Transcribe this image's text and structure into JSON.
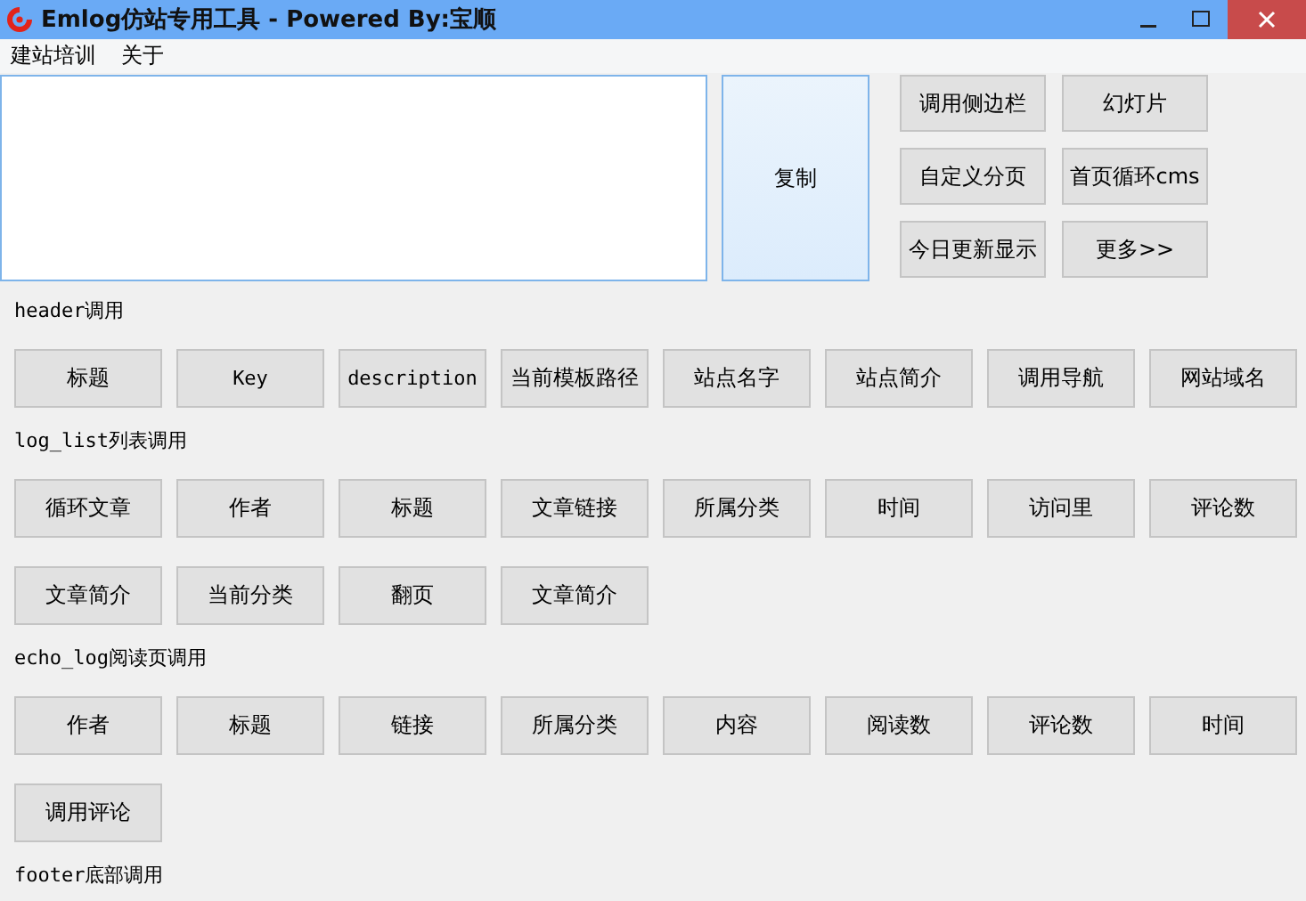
{
  "window": {
    "title": "Emlog仿站专用工具 - Powered By:宝顺"
  },
  "menu": [
    {
      "label": "建站培训"
    },
    {
      "label": "关于"
    }
  ],
  "copy_button": {
    "label": "复制"
  },
  "quick_buttons": [
    {
      "label": "调用侧边栏"
    },
    {
      "label": "幻灯片"
    },
    {
      "label": "自定义分页"
    },
    {
      "label": "首页循环cms"
    },
    {
      "label": "今日更新显示"
    },
    {
      "label": "更多>>"
    }
  ],
  "sections": [
    {
      "title": "header调用",
      "buttons": [
        "标题",
        "Key",
        "description",
        "当前模板路径",
        "站点名字",
        "站点简介",
        "调用导航",
        "网站域名"
      ]
    },
    {
      "title": "log_list列表调用",
      "buttons": [
        "循环文章",
        "作者",
        "标题",
        "文章链接",
        "所属分类",
        "时间",
        "访问里",
        "评论数",
        "文章简介",
        "当前分类",
        "翻页",
        "文章简介"
      ]
    },
    {
      "title": "echo_log阅读页调用",
      "buttons": [
        "作者",
        "标题",
        "链接",
        "所属分类",
        "内容",
        "阅读数",
        "评论数",
        "时间",
        "调用评论"
      ]
    },
    {
      "title": "footer底部调用"
    }
  ]
}
